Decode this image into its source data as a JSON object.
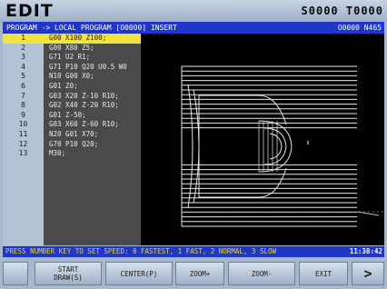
{
  "mode": "EDIT",
  "spindle_feed": "S0000 T0000",
  "header": {
    "path": "PROGRAM -> LOCAL PROGRAM [O0000]  INSERT",
    "prog_id": "O0000 N465"
  },
  "program": [
    {
      "n": "1",
      "code": "G00 X100 Z100;"
    },
    {
      "n": "2",
      "code": "G00 X80 Z5;"
    },
    {
      "n": "3",
      "code": "G71 U2 R1;"
    },
    {
      "n": "4",
      "code": "G71 P10 Q20 U0.5 W0"
    },
    {
      "n": "5",
      "code": "N10 G00 X0;"
    },
    {
      "n": "6",
      "code": "G01 Z0;"
    },
    {
      "n": "7",
      "code": "G03 X20 Z-10 R10;"
    },
    {
      "n": "8",
      "code": "G02 X40 Z-20 R10;"
    },
    {
      "n": "9",
      "code": "G01 Z-50;"
    },
    {
      "n": "10",
      "code": "G03 X60 Z-60 R10;"
    },
    {
      "n": "11",
      "code": "N20 G01 X70;"
    },
    {
      "n": "12",
      "code": "G70 P10 Q20;"
    },
    {
      "n": "13",
      "code": "M30;"
    }
  ],
  "status": {
    "message": "PRESS NUMBER KEY TO SET SPEED: 0 FASTEST, 1 FAST, 2 NORMAL, 3 SLOW",
    "clock": "11:38:42"
  },
  "softkeys": {
    "start_draw": "START\nDRAW(S)",
    "center": "CENTER(P)",
    "zoom_in": "ZOOM+",
    "zoom_out": "ZOOM-",
    "exit": "EXIT",
    "next": ">"
  }
}
